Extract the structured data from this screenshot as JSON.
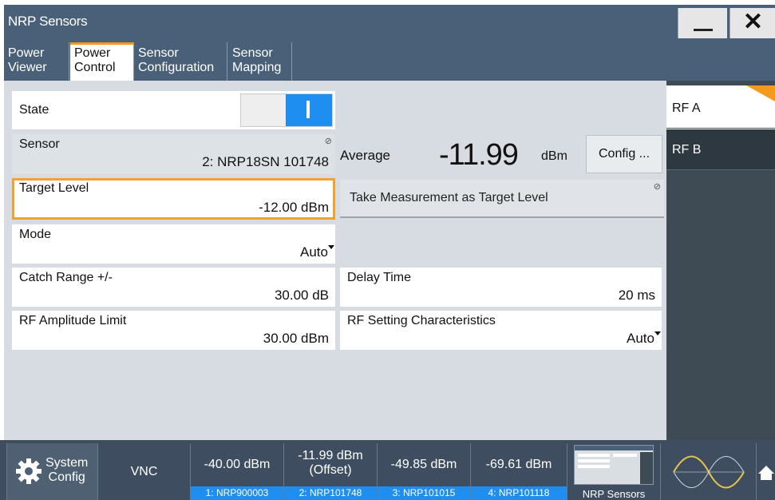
{
  "window": {
    "title": "NRP Sensors"
  },
  "tabs": [
    {
      "line1": "Power",
      "line2": "Viewer"
    },
    {
      "line1": "Power",
      "line2": "Control"
    },
    {
      "line1": "Sensor",
      "line2": "Configuration"
    },
    {
      "line1": "Sensor",
      "line2": "Mapping"
    }
  ],
  "form": {
    "state": {
      "label": "State"
    },
    "sensor": {
      "label": "Sensor",
      "value": "2: NRP18SN 101748"
    },
    "target_level": {
      "label": "Target Level",
      "value": "-12.00 dBm"
    },
    "mode": {
      "label": "Mode",
      "value": "Auto"
    },
    "catch_range": {
      "label": "Catch Range +/-",
      "value": "30.00 dB"
    },
    "rf_amp_limit": {
      "label": "RF Amplitude Limit",
      "value": "30.00 dBm"
    },
    "delay_time": {
      "label": "Delay Time",
      "value": "20 ms"
    },
    "rf_setting": {
      "label": "RF Setting Characteristics",
      "value": "Auto"
    }
  },
  "measurement": {
    "average_label": "Average",
    "average_value": "-11.99",
    "unit": "dBm",
    "config_button": "Config ...",
    "take_button": "Take Measurement as Target Level"
  },
  "rf_panel": {
    "rf_a": "RF A",
    "rf_b": "RF B"
  },
  "taskbar": {
    "system_line1": "System",
    "system_line2": "Config",
    "vnc": "VNC",
    "sensors": [
      {
        "value": "-40.00 dBm",
        "value2": "",
        "label": "1: NRP900003"
      },
      {
        "value": "-11.99 dBm",
        "value2": "(Offset)",
        "label": "2: NRP101748"
      },
      {
        "value": "-49.85 dBm",
        "value2": "",
        "label": "3: NRP101015"
      },
      {
        "value": "-69.61 dBm",
        "value2": "",
        "label": "4: NRP101118"
      }
    ],
    "nrp_sensors": "NRP Sensors"
  },
  "colors": {
    "accent": "#f59a1f",
    "highlight": "#1f8ef1",
    "titlebar": "#4a6078"
  }
}
